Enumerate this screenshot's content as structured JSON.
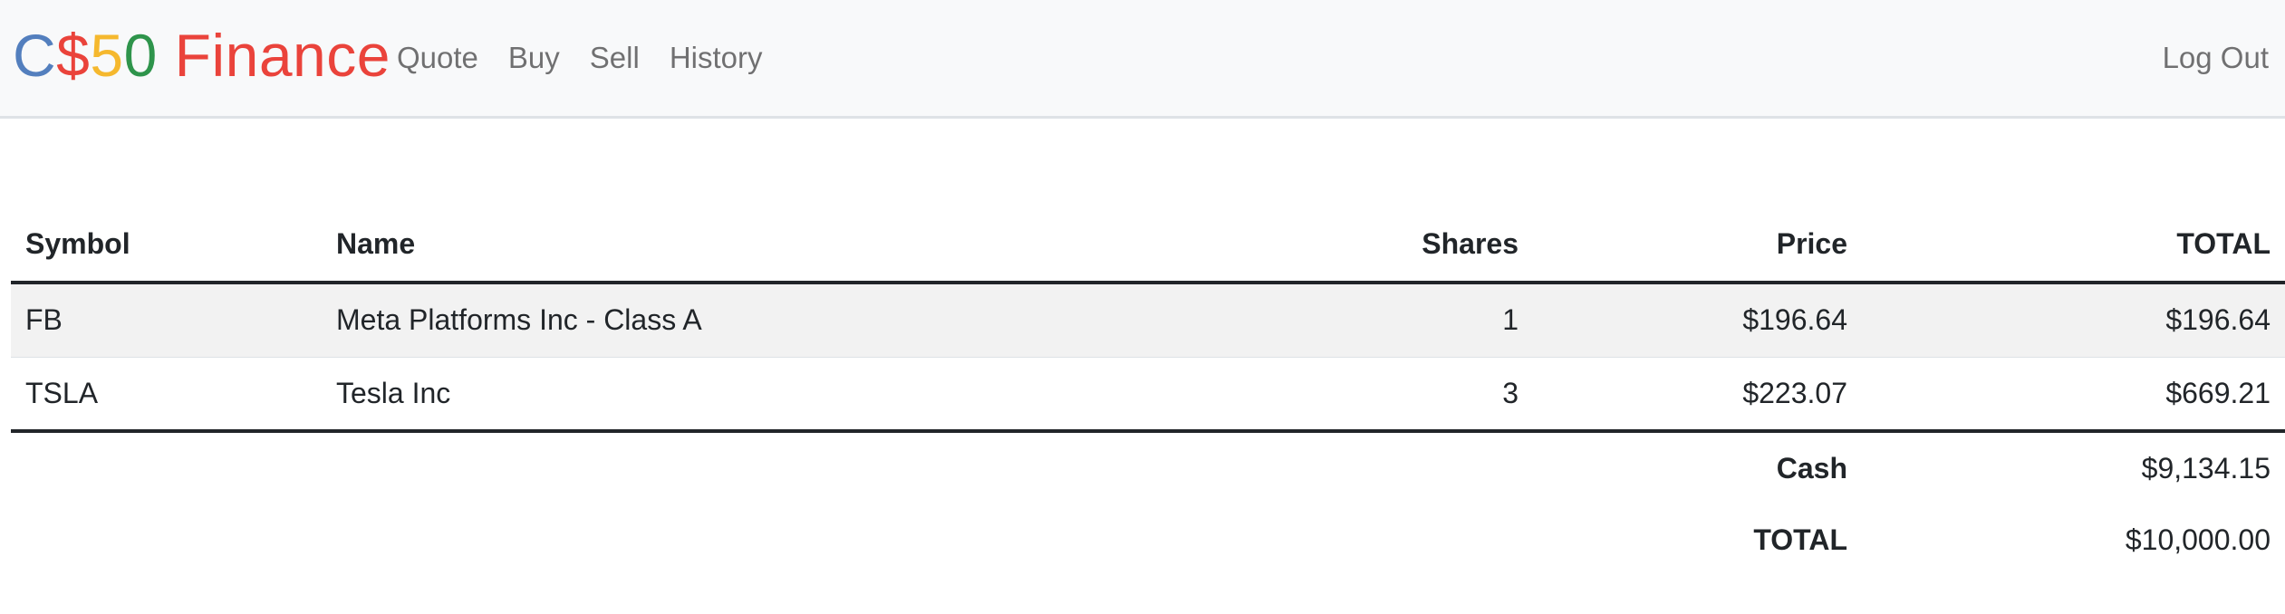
{
  "brand": {
    "c": "C",
    "dollar": "$",
    "five": "5",
    "zero": "0",
    "rest": " Finance",
    "colors": {
      "blue": "#537fbe",
      "red": "#ea433b",
      "yellow": "#f5b82e",
      "green": "#2e944b"
    }
  },
  "nav": {
    "links": [
      {
        "label": "Quote"
      },
      {
        "label": "Buy"
      },
      {
        "label": "Sell"
      },
      {
        "label": "History"
      }
    ],
    "logout": "Log Out"
  },
  "table": {
    "headers": {
      "symbol": "Symbol",
      "name": "Name",
      "shares": "Shares",
      "price": "Price",
      "total": "TOTAL"
    },
    "rows": [
      {
        "symbol": "FB",
        "name": "Meta Platforms Inc - Class A",
        "shares": "1",
        "price": "$196.64",
        "total": "$196.64"
      },
      {
        "symbol": "TSLA",
        "name": "Tesla Inc",
        "shares": "3",
        "price": "$223.07",
        "total": "$669.21"
      }
    ],
    "footer": {
      "cash_label": "Cash",
      "cash_value": "$9,134.15",
      "total_label": "TOTAL",
      "total_value": "$10,000.00"
    }
  }
}
